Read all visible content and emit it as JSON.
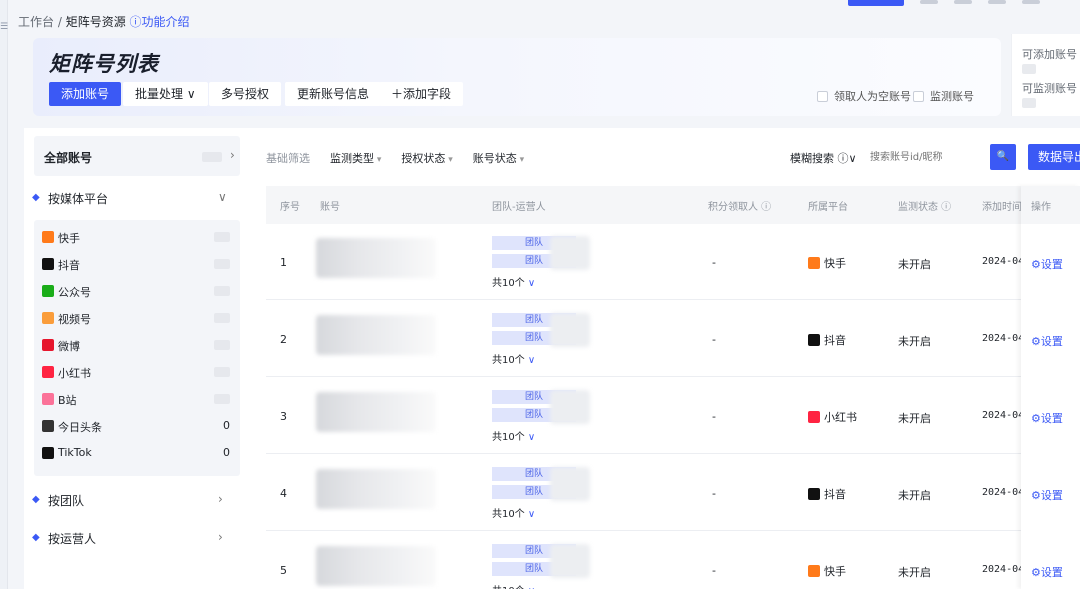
{
  "breadcrumb": {
    "root": "工作台",
    "sep": " / ",
    "current": "矩阵号资源",
    "help": "ⓘ功能介绍"
  },
  "header": {
    "title": "矩阵号列表",
    "buttons": {
      "add": "添加账号",
      "batch": "批量处理 ∨",
      "auth": "多号授权",
      "update": "更新账号信息",
      "add_field": "＋添加字段"
    },
    "checkboxes": {
      "empty_receiver": "领取人为空账号",
      "monitor": "监测账号"
    }
  },
  "quota": {
    "can_add": "可添加账号",
    "can_monitor": "可监测账号"
  },
  "left_panel": {
    "all_accounts": "全部账号",
    "by_platform": "按媒体平台",
    "by_team": "按团队",
    "by_operator": "按运营人",
    "platforms": [
      {
        "label": "快手",
        "count": "",
        "color": "#ff7a1a",
        "icon": "kuaishou-icon"
      },
      {
        "label": "抖音",
        "count": "",
        "color": "#111111",
        "icon": "douyin-icon"
      },
      {
        "label": "公众号",
        "count": "",
        "color": "#1aad19",
        "icon": "wechat-mp-icon"
      },
      {
        "label": "视频号",
        "count": "",
        "color": "#fa9d3b",
        "icon": "channels-icon"
      },
      {
        "label": "微博",
        "count": "",
        "color": "#e6162d",
        "icon": "weibo-icon"
      },
      {
        "label": "小红书",
        "count": "",
        "color": "#ff2442",
        "icon": "xiaohongshu-icon"
      },
      {
        "label": "B站",
        "count": "",
        "color": "#fb7299",
        "icon": "bilibili-icon"
      },
      {
        "label": "今日头条",
        "count": "0",
        "color": "#333333",
        "icon": "toutiao-icon"
      },
      {
        "label": "TikTok",
        "count": "0",
        "color": "#111111",
        "icon": "tiktok-icon"
      }
    ]
  },
  "filters": {
    "base": "基础筛选",
    "monitor_type": "监测类型",
    "auth_status": "授权状态",
    "account_status": "账号状态",
    "fuzzy": "模糊搜索 ⓘ∨",
    "search_placeholder": "搜索账号id/昵称",
    "export": "数据导出"
  },
  "table": {
    "headers": {
      "seq": "序号",
      "account": "账号",
      "team": "团队-运营人",
      "points": "积分领取人 ⓘ",
      "platform": "所属平台",
      "monitor": "监测状态 ⓘ",
      "added": "添加时间",
      "op": "操作"
    },
    "team_tag": "团队",
    "team_total": "共10个",
    "rows": [
      {
        "seq": "1",
        "points": "-",
        "platform": "快手",
        "platform_color": "#ff7a1a",
        "monitor": "未开启",
        "added": "2024-04",
        "op": "⚙设置"
      },
      {
        "seq": "2",
        "points": "-",
        "platform": "抖音",
        "platform_color": "#111111",
        "monitor": "未开启",
        "added": "2024-04",
        "op": "⚙设置"
      },
      {
        "seq": "3",
        "points": "-",
        "platform": "小红书",
        "platform_color": "#ff2442",
        "monitor": "未开启",
        "added": "2024-04",
        "op": "⚙设置"
      },
      {
        "seq": "4",
        "points": "-",
        "platform": "抖音",
        "platform_color": "#111111",
        "monitor": "未开启",
        "added": "2024-04",
        "op": "⚙设置"
      },
      {
        "seq": "5",
        "points": "-",
        "platform": "快手",
        "platform_color": "#ff7a1a",
        "monitor": "未开启",
        "added": "2024-04",
        "op": "⚙设置"
      }
    ]
  }
}
